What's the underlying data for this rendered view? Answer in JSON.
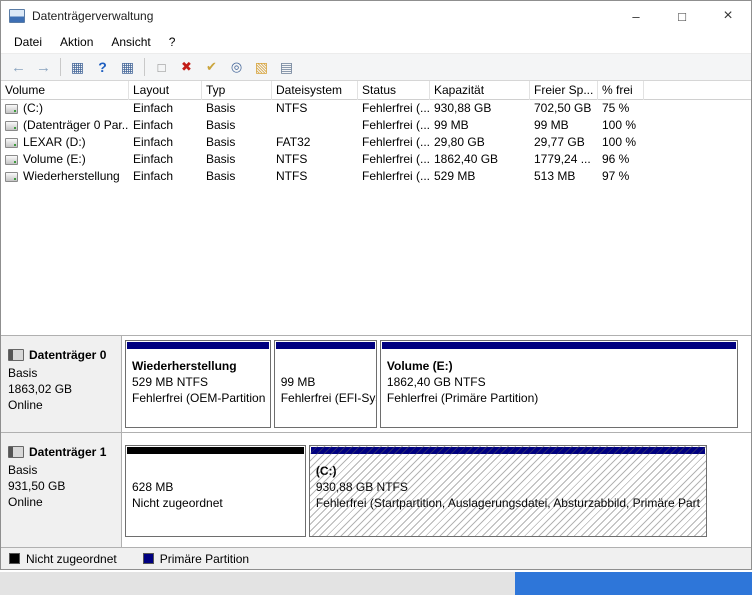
{
  "window": {
    "title": "Datenträgerverwaltung",
    "controls": {
      "minimize": "–",
      "maximize": "□",
      "close": "×"
    }
  },
  "menu": {
    "items": [
      "Datei",
      "Aktion",
      "Ansicht",
      "?"
    ]
  },
  "toolbar": {
    "icons": [
      {
        "name": "back",
        "glyph": "←"
      },
      {
        "name": "forward",
        "glyph": "→"
      },
      {
        "name": "console-tree",
        "glyph": "▦"
      },
      {
        "name": "help",
        "glyph": "?"
      },
      {
        "name": "properties-window",
        "glyph": "▦"
      },
      {
        "name": "command",
        "glyph": "□"
      },
      {
        "name": "delete-volume",
        "glyph": "✖"
      },
      {
        "name": "mark-active",
        "glyph": "✔"
      },
      {
        "name": "explore",
        "glyph": "◎"
      },
      {
        "name": "open-folder",
        "glyph": "▧"
      },
      {
        "name": "list-view",
        "glyph": "▤"
      }
    ]
  },
  "volume_table": {
    "columns": [
      "Volume",
      "Layout",
      "Typ",
      "Dateisystem",
      "Status",
      "Kapazität",
      "Freier Sp...",
      "% frei"
    ],
    "rows": [
      [
        "(C:)",
        "Einfach",
        "Basis",
        "NTFS",
        "Fehlerfrei (...",
        "930,88 GB",
        "702,50 GB",
        "75 %"
      ],
      [
        "(Datenträger 0 Par...",
        "Einfach",
        "Basis",
        "",
        "Fehlerfrei (...",
        "99 MB",
        "99 MB",
        "100 %"
      ],
      [
        "LEXAR (D:)",
        "Einfach",
        "Basis",
        "FAT32",
        "Fehlerfrei (...",
        "29,80 GB",
        "29,77 GB",
        "100 %"
      ],
      [
        "Volume (E:)",
        "Einfach",
        "Basis",
        "NTFS",
        "Fehlerfrei (...",
        "1862,40 GB",
        "1779,24 ...",
        "96 %"
      ],
      [
        "Wiederherstellung",
        "Einfach",
        "Basis",
        "NTFS",
        "Fehlerfrei (...",
        "529 MB",
        "513 MB",
        "97 %"
      ]
    ]
  },
  "disks": [
    {
      "label": "Datenträger 0",
      "type": "Basis",
      "size": "1863,02 GB",
      "status": "Online",
      "partitions": [
        {
          "title": "Wiederherstellung",
          "size": "529 MB NTFS",
          "status": "Fehlerfrei (OEM-Partition",
          "width": "24%",
          "band_color": "#000080"
        },
        {
          "title": "",
          "size": "99 MB",
          "status": "Fehlerfrei (EFI-Sys",
          "width": "17%",
          "band_color": "#000080"
        },
        {
          "title": "Volume  (E:)",
          "size": "1862,40 GB NTFS",
          "status": "Fehlerfrei (Primäre Partition)",
          "width": "59%",
          "band_color": "#000080"
        }
      ]
    },
    {
      "label": "Datenträger 1",
      "type": "Basis",
      "size": "931,50 GB",
      "status": "Online",
      "partitions": [
        {
          "title": "",
          "size": "628 MB",
          "status": "Nicht zugeordnet",
          "width": "29.5%",
          "band_color": "#000000"
        },
        {
          "title": "(C:)",
          "size": "930,88 GB NTFS",
          "status": "Fehlerfrei (Startpartition, Auslagerungsdatei, Absturzabbild, Primäre Part",
          "width": "65%",
          "band_color": "#000080"
        }
      ]
    }
  ],
  "legend": {
    "items": [
      {
        "label": "Nicht zugeordnet",
        "color": "#000000"
      },
      {
        "label": "Primäre Partition",
        "color": "#000080"
      }
    ]
  },
  "colors": {
    "primary_partition": "#000080",
    "unallocated": "#000000",
    "taskbar_accent": "#2e76d9"
  }
}
